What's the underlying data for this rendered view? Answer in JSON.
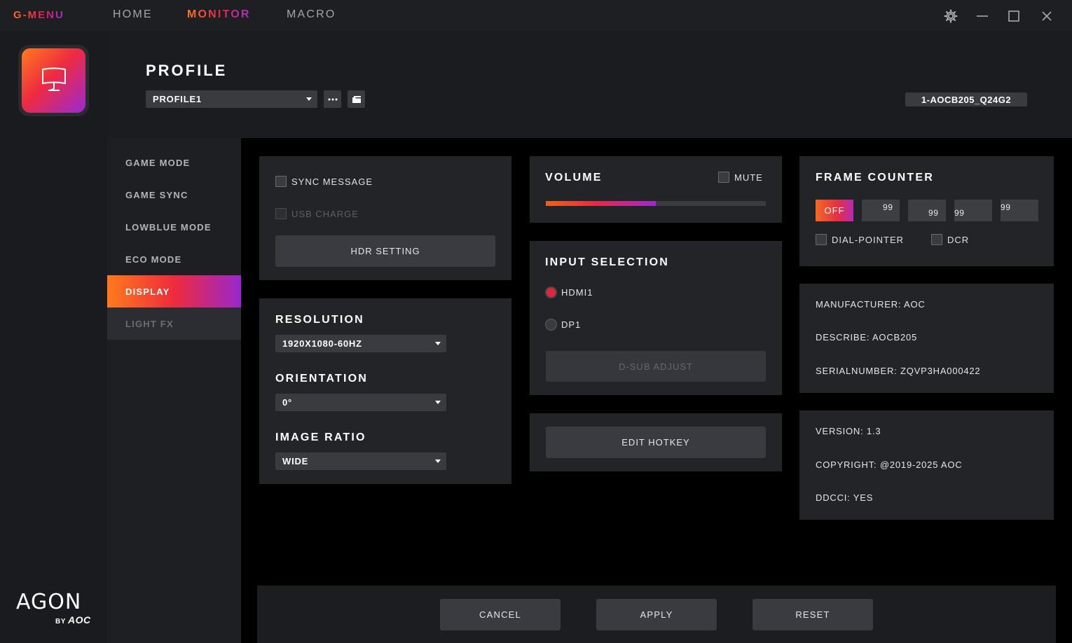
{
  "app": {
    "logo": "G-MENU",
    "tabs": [
      "HOME",
      "MONITOR",
      "MACRO"
    ],
    "active_tab": "MONITOR"
  },
  "window_controls": {
    "settings_icon": "gear-icon",
    "minimize_icon": "minimize-icon",
    "maximize_icon": "maximize-icon",
    "close_icon": "close-icon"
  },
  "profile": {
    "title": "PROFILE",
    "selected": "PROFILE1",
    "more_icon": "ellipsis-icon",
    "folder_icon": "folder-icon",
    "monitor_id": "1-AOCB205_Q24G2"
  },
  "sidebar": {
    "items": [
      {
        "label": "GAME MODE"
      },
      {
        "label": "GAME SYNC"
      },
      {
        "label": "LOWBLUE MODE"
      },
      {
        "label": "ECO MODE"
      },
      {
        "label": "DISPLAY"
      },
      {
        "label": "LIGHT FX"
      }
    ],
    "active": "DISPLAY"
  },
  "brand": {
    "name": "AGON",
    "by": "BY",
    "maker": "AOC"
  },
  "display_options": {
    "sync_message": "SYNC MESSAGE",
    "usb_charge": "USB CHARGE",
    "hdr_setting": "HDR SETTING"
  },
  "resolution": {
    "resolution_label": "RESOLUTION",
    "resolution_value": "1920X1080-60HZ",
    "orientation_label": "ORIENTATION",
    "orientation_value": "0°",
    "ratio_label": "IMAGE RATIO",
    "ratio_value": "WIDE"
  },
  "volume": {
    "title": "VOLUME",
    "mute": "MUTE",
    "level": 0.5
  },
  "input": {
    "title": "INPUT SELECTION",
    "options": [
      "HDMI1",
      "DP1"
    ],
    "selected": "HDMI1",
    "dsub": "D-SUB ADJUST"
  },
  "hotkey": {
    "label": "EDIT HOTKEY"
  },
  "frame_counter": {
    "title": "FRAME COUNTER",
    "state": "OFF",
    "values": [
      "99",
      "99",
      "99",
      "99"
    ],
    "dial_pointer": "DIAL-POINTER",
    "dcr": "DCR"
  },
  "monitor_info": {
    "manufacturer": "MANUFACTURER: AOC",
    "describe": "DESCRIBE: AOCB205",
    "serial": "SERIALNUMBER: ZQVP3HA000422"
  },
  "app_info": {
    "version": "VERSION: 1.3",
    "copyright": "COPYRIGHT: @2019-2025 AOC",
    "ddcci": "DDCCI: YES"
  },
  "actions": {
    "cancel": "CANCEL",
    "apply": "APPLY",
    "reset": "RESET"
  },
  "colors": {
    "accent_orange": "#ff7a1d",
    "accent_red": "#ee2b3c",
    "accent_purple": "#9827cf"
  }
}
